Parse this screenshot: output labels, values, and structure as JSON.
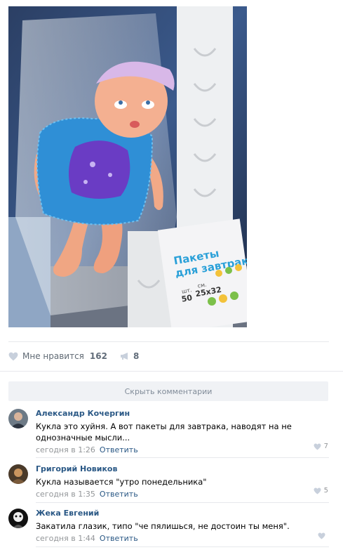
{
  "post": {
    "likes_label": "Мне нравится",
    "likes_count": "162",
    "shares_count": "8"
  },
  "photo": {
    "package_label_line1": "Пакеты",
    "package_label_line2": "для завтрака",
    "package_small_left": "шт.",
    "package_small_right": "см.",
    "package_count": "50",
    "package_size": "25x32"
  },
  "comments_section": {
    "hide_label": "Скрыть комментарии"
  },
  "comments": [
    {
      "author": "Александр Кочергин",
      "text": "Кукла это хуйня. А вот пакеты для завтрака, наводят на не однозначные мысли...",
      "date": "сегодня в 1:26",
      "reply": "Ответить",
      "likes": "7"
    },
    {
      "author": "Григорий Новиков",
      "text": "Кукла называется \"утро понедельника\"",
      "date": "сегодня в 1:35",
      "reply": "Ответить",
      "likes": "5"
    },
    {
      "author": "Жека Евгений",
      "text": "Закатила глазик, типо \"че пялишься, не достоин ты меня\".",
      "date": "сегодня в 1:44",
      "reply": "Ответить",
      "likes": ""
    }
  ],
  "colors": {
    "link": "#2a5885",
    "meta": "#939699",
    "divider": "#e7e8ec",
    "button_bg": "#f0f2f5"
  }
}
